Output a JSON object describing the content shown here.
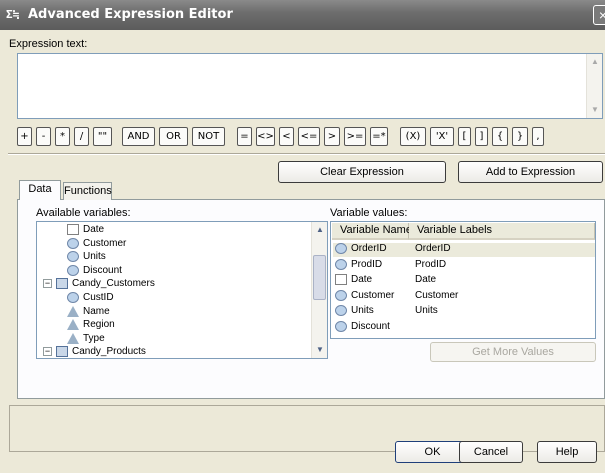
{
  "title": "Advanced Expression Editor",
  "title_icon": "Σ≒",
  "close_glyph": "×",
  "expression_label": "Expression text:",
  "expression_value": "",
  "operators": [
    "+",
    "-",
    "*",
    "/",
    "\"\"",
    "AND",
    "OR",
    "NOT",
    "=",
    "<>",
    "<",
    "<=",
    ">",
    ">=",
    "=*",
    "(X)",
    "'X'",
    "[",
    "]",
    "{",
    "}",
    ","
  ],
  "buttons": {
    "clear": "Clear Expression",
    "add": "Add to Expression",
    "get_more": "Get More Values",
    "ok": "OK",
    "cancel": "Cancel",
    "help": "Help"
  },
  "tabs": [
    "Data",
    "Functions"
  ],
  "available_variables_label": "Available variables:",
  "tree_items": [
    {
      "label": "Date",
      "icon": "date-icon",
      "level": 2
    },
    {
      "label": "Customer",
      "icon": "variable-icon",
      "level": 2
    },
    {
      "label": "Units",
      "icon": "variable-icon",
      "level": 2
    },
    {
      "label": "Discount",
      "icon": "variable-icon",
      "level": 2
    },
    {
      "label": "Candy_Customers",
      "icon": "table-icon",
      "level": 1,
      "expander": "−"
    },
    {
      "label": "CustID",
      "icon": "variable-icon",
      "level": 2
    },
    {
      "label": "Name",
      "icon": "attribute-icon",
      "level": 2
    },
    {
      "label": "Region",
      "icon": "attribute-icon",
      "level": 2
    },
    {
      "label": "Type",
      "icon": "attribute-icon",
      "level": 2
    },
    {
      "label": "Candy_Products",
      "icon": "table-icon",
      "level": 1,
      "expander": "−"
    }
  ],
  "variable_values_label": "Variable values:",
  "grid_headers": [
    "Variable Names",
    "Variable Labels"
  ],
  "grid_rows": [
    {
      "name": "OrderID",
      "label": "OrderID",
      "icon": "variable-icon"
    },
    {
      "name": "ProdID",
      "label": "ProdID",
      "icon": "variable-icon"
    },
    {
      "name": "Date",
      "label": "Date",
      "icon": "date-icon"
    },
    {
      "name": "Customer",
      "label": "Customer",
      "icon": "variable-icon"
    },
    {
      "name": "Units",
      "label": "Units",
      "icon": "variable-icon"
    },
    {
      "name": "Discount",
      "label": "",
      "icon": "variable-icon"
    }
  ],
  "scroll_glyphs": {
    "up": "▲",
    "down": "▼"
  }
}
